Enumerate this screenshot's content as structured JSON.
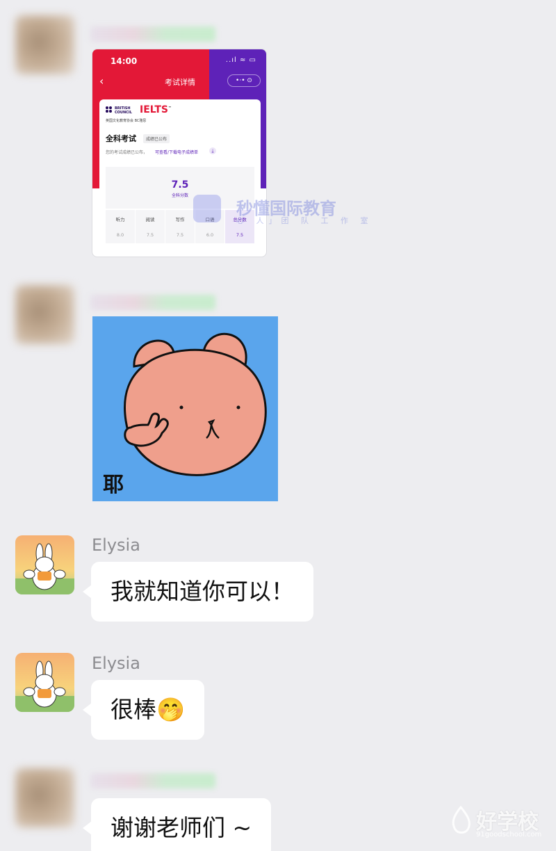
{
  "messages": [
    {
      "sender": "",
      "type": "image",
      "content": "ielts-screenshot"
    },
    {
      "sender": "",
      "type": "sticker",
      "content": "bear-sticker"
    },
    {
      "sender": "Elysia",
      "type": "text",
      "text": "我就知道你可以！"
    },
    {
      "sender": "Elysia",
      "type": "text",
      "text": "很棒🤭"
    },
    {
      "sender": "",
      "type": "text",
      "text": "谢谢老师们 ~"
    }
  ],
  "ielts_card": {
    "time": "14:00",
    "status_icons": "..ıl ≈ ▭",
    "page_title": "考试详情",
    "capsule": "•·•  ⊙",
    "bc_text_1": "BRITISH",
    "bc_text_2": "COUNCIL",
    "brand": "IELTS",
    "brand_tm": "™",
    "org_sub": "英国文化教育协会 BC雅思",
    "exam_title": "全科考试",
    "badge": "成绩已公布",
    "note": "您的考试成绩已公布，",
    "link": "可查看/下载电子成绩单",
    "overall_score": "7.5",
    "overall_label": "全科分数",
    "subscores": [
      {
        "label": "听力",
        "value": "8.0"
      },
      {
        "label": "阅读",
        "value": "7.5"
      },
      {
        "label": "写作",
        "value": "7.5"
      },
      {
        "label": "口语",
        "value": "6.0"
      },
      {
        "label": "总分数",
        "value": "7.5"
      }
    ]
  },
  "watermark": {
    "main": "秒懂国际教育",
    "sub": "心 人」团 队 工 作 室"
  },
  "sticker": {
    "caption": "耶"
  },
  "bottom_watermark": {
    "main": "好学校",
    "sub": "91goodschool.com"
  },
  "colors": {
    "ielts_red": "#e31837",
    "ielts_purple": "#5e22b8",
    "chat_bg": "#ededf0",
    "bubble": "#ffffff"
  }
}
